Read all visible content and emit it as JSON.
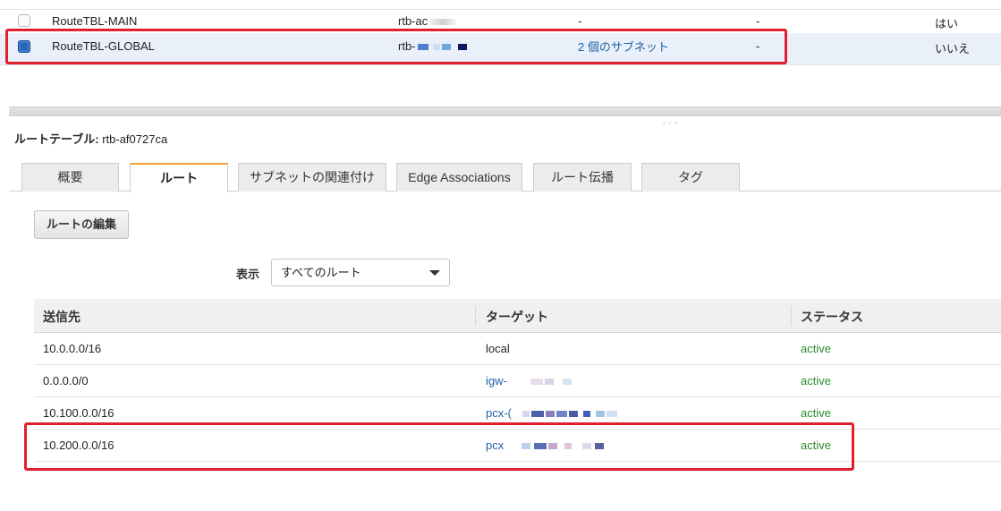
{
  "route_tables": [
    {
      "name": "RouteTBL-MAIN",
      "id": "rtb-ac",
      "subnets": "-",
      "edge": "-",
      "main": "はい",
      "selected": false
    },
    {
      "name": "RouteTBL-GLOBAL",
      "id": "rtb-",
      "subnets": "2 個のサブネット",
      "edge": "-",
      "main": "いいえ",
      "selected": true
    }
  ],
  "detail": {
    "label": "ルートテーブル:",
    "id": "rtb-af0727ca"
  },
  "tabs": [
    "概要",
    "ルート",
    "サブネットの関連付け",
    "Edge Associations",
    "ルート伝播",
    "タグ"
  ],
  "active_tab": "ルート",
  "edit_button": "ルートの編集",
  "filter": {
    "label": "表示",
    "selected": "すべてのルート"
  },
  "routes_table": {
    "headers": [
      "送信先",
      "ターゲット",
      "ステータス"
    ],
    "rows": [
      {
        "destination": "10.0.0.0/16",
        "target": "local",
        "status": "active"
      },
      {
        "destination": "0.0.0.0/0",
        "target": "igw-",
        "status": "active"
      },
      {
        "destination": "10.100.0.0/16",
        "target": "pcx-(",
        "status": "active"
      },
      {
        "destination": "10.200.0.0/16",
        "target": "pcx",
        "status": "active"
      }
    ]
  },
  "colors": {
    "highlight": "#e0202e",
    "link": "#1f5fa8",
    "status_active": "#2e8b2e",
    "tab_active_accent": "#f0a030"
  }
}
